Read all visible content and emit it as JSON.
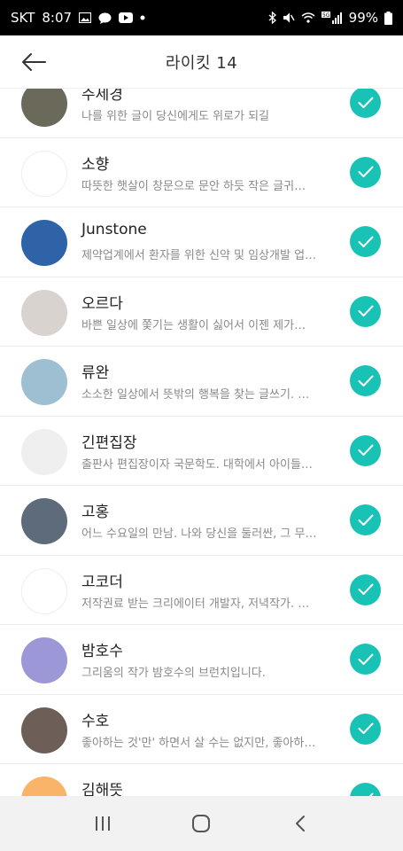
{
  "status_bar": {
    "carrier": "SKT",
    "time": "8:07",
    "battery": "99%",
    "left_icons": [
      "image-icon",
      "chat-icon",
      "youtube-icon",
      "dot-icon"
    ],
    "right_icons": [
      "bluetooth-icon",
      "mute-icon",
      "wifi-icon",
      "5g-signal-icon",
      "battery-icon"
    ]
  },
  "header": {
    "title": "라이킷 14",
    "back_icon": "back-arrow-icon"
  },
  "colors": {
    "accent": "#18c3b6",
    "status_bg": "#000000",
    "nav_bg": "#f2f2f2"
  },
  "items": [
    {
      "name": "주세경",
      "desc": "나를 위한 글이 당신에게도 위로가 되길",
      "checked": true,
      "avatar_color": "#6b6a5a"
    },
    {
      "name": "소향",
      "desc": "따뜻한 햇살이 창문으로 문안 하듯 작은 글귀…",
      "checked": true,
      "avatar_color": "#ffffff"
    },
    {
      "name": "Junstone",
      "desc": "제약업계에서 환자를 위한 신약 및 임상개발 업…",
      "checked": true,
      "avatar_color": "#2f63a8"
    },
    {
      "name": "오르다",
      "desc": "바쁜 일상에 쫓기는 생활이 싫어서 이젠 제가…",
      "checked": true,
      "avatar_color": "#d9d3cf"
    },
    {
      "name": "류완",
      "desc": "소소한 일상에서 뜻밖의 행복을 찾는 글쓰기. …",
      "checked": true,
      "avatar_color": "#9dbfd1"
    },
    {
      "name": "긴편집장",
      "desc": "출판사 편집장이자 국문학도. 대학에서 아이들…",
      "checked": true,
      "avatar_color": "#efefef"
    },
    {
      "name": "고홍",
      "desc": "어느 수요일의 만남. 나와 당신을 둘러싼, 그 무…",
      "checked": true,
      "avatar_color": "#5d6b7a"
    },
    {
      "name": "고코더",
      "desc": "저작권료 받는 크리에이터 개발자, 저녁작가. …",
      "checked": true,
      "avatar_color": "#ffffff"
    },
    {
      "name": "밤호수",
      "desc": "그리움의 작가 밤호수의 브런치입니다.",
      "checked": true,
      "avatar_color": "#9c97d6"
    },
    {
      "name": "수호",
      "desc": "좋아하는 것'만' 하면서 살 수는 없지만, 좋아하…",
      "checked": true,
      "avatar_color": "#6d5e57"
    },
    {
      "name": "김해뜻",
      "desc": "",
      "checked": true,
      "avatar_color": "#f9b46a"
    }
  ],
  "nav": {
    "recent_icon": "recent-apps-icon",
    "home_icon": "home-icon",
    "back_icon": "nav-back-icon"
  }
}
